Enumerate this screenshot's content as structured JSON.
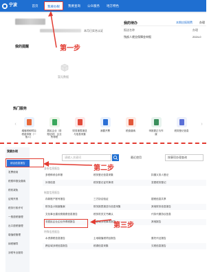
{
  "header": {
    "logo_text": "宁波",
    "nav": [
      "首页",
      "我要办税",
      "我要查询",
      "公众服务",
      "地方特色"
    ]
  },
  "user": {
    "auth_text": "本月已实名认证"
  },
  "todo": {
    "title": "我的待办",
    "tabs": [
      "本期应报税费",
      "办理"
    ],
    "columns": [
      "报送名称",
      "办理"
    ],
    "row": {
      "name": "残疾人就业保障金申报",
      "date": "2024-0"
    }
  },
  "apps": {
    "title": "我的提醒",
    "empty_text": "暂无数据"
  },
  "annotations": {
    "step1": "第一步",
    "step2": "第二步",
    "step3": "第三步"
  },
  "hot": {
    "title": "热门服务",
    "items": [
      {
        "label": "增值税和附加税费申报（一般人）",
        "color": "#e9f1fd",
        "accent": "#e86a3a"
      },
      {
        "label": "居民企业（查账征收）企业所得税",
        "color": "#eef6ea",
        "accent": "#3aa85c"
      },
      {
        "label": "财务报表报送与信息采集",
        "color": "#fde9e9",
        "accent": "#e24a3a"
      },
      {
        "label": "我要开票",
        "color": "#e9f1fd",
        "accent": "#2a6fd6"
      },
      {
        "label": "税费缴纳",
        "color": "#fdebe6",
        "accent": "#e2583a"
      },
      {
        "label": "申报更正与作废",
        "color": "#e8f3ee",
        "accent": "#3a8f5c"
      },
      {
        "label": "税务登记信息",
        "color": "#eef1fb",
        "accent": "#5a6fd6"
      }
    ]
  },
  "side_menu": {
    "title": "我要办税",
    "items": [
      "综合信息报告",
      "发票使用",
      "税费申报及缴纳",
      "税收减免",
      "证明开具",
      "税务行政许可",
      "一般退税管理",
      "出口退税管理",
      "增值税管理",
      "纳税辅导",
      "涉税专业服务"
    ]
  },
  "search": {
    "placeholder": "请输入关键词",
    "cap_label": "最近使用",
    "select_value": "按事项办理查询"
  },
  "sections": [
    {
      "title": "身份信息报告",
      "rows": [
        [
          "多税种综合申报",
          "税务登记信息采集",
          "扣缴义务人登记"
        ],
        [
          "补录信息",
          "税务登记证件换领",
          "变更税务登记"
        ]
      ]
    },
    {
      "title": "制度信息报告",
      "rows": [
        [
          "存款账户账号报告",
          "三方协议验证",
          "银税信息共享"
        ],
        [
          "财务会计制度备案",
          "财务报表报送与信息采集",
          "其他财务信息报告"
        ],
        [
          "文化事业建设费缴费信息报告",
          "税务机关文书确认",
          "代扣代缴协议信息"
        ],
        [
          "非居民企业企业所得税报告",
          "跨区域涉税事项报告",
          "其他报告"
        ]
      ]
    },
    {
      "title": "特殊信息报告",
      "rows": [
        [
          "水资源税信息报告",
          "土地增值税项目报告",
          "委托代征报告"
        ],
        [
          "跨区域涉税信息报告",
          "税源信息采集",
          "欠税信息报告"
        ]
      ]
    }
  ],
  "colors": {
    "brand": "#1f6fd1",
    "annotation": "#e23a30"
  }
}
